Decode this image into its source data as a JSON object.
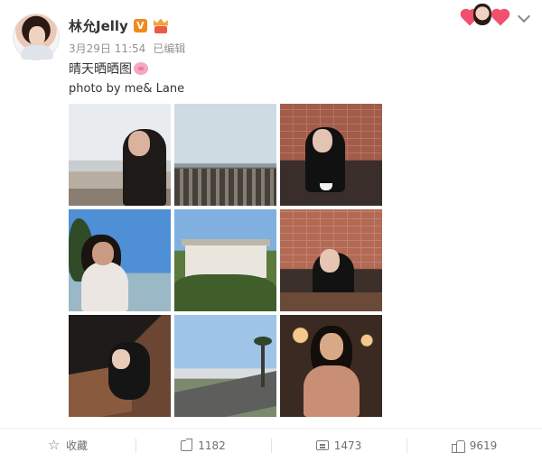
{
  "post": {
    "author": "林允Jelly",
    "verified_badge": "V",
    "time": "3月29日 11:54",
    "edited": "已编辑",
    "text": "晴天晒晒图",
    "credit": "photo by me& Lane"
  },
  "photos": [
    {
      "icon": "beach-balcony-photo"
    },
    {
      "icon": "parking-lot-pier-photo"
    },
    {
      "icon": "brick-wall-cafe-photo"
    },
    {
      "icon": "sunglasses-palm-photo"
    },
    {
      "icon": "white-house-photo"
    },
    {
      "icon": "brick-wall-table-photo"
    },
    {
      "icon": "cafe-booth-photo"
    },
    {
      "icon": "beach-road-photo"
    },
    {
      "icon": "bar-portrait-photo"
    }
  ],
  "actions": {
    "favorite_label": "收藏",
    "repost_count": "1182",
    "comment_count": "1473",
    "like_count": "9619"
  },
  "colors": {
    "verified": "#f08a1c",
    "meta_text": "#939393",
    "action_text": "#6f6f6f"
  }
}
